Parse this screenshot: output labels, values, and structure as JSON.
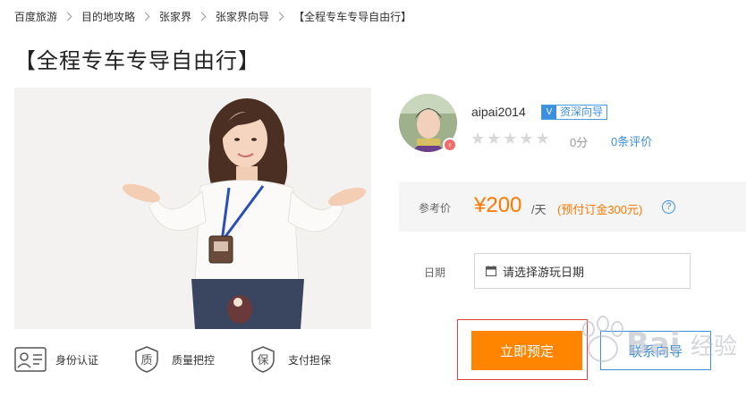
{
  "breadcrumb": [
    "百度旅游",
    "目的地攻略",
    "张家界",
    "张家界向导",
    "【全程专车专导自由行】"
  ],
  "page": {
    "title": "【全程专车专导自由行】"
  },
  "guarantees": [
    {
      "icon": "id-card-icon",
      "label": "身份认证"
    },
    {
      "icon": "quality-icon",
      "label": "质量把控"
    },
    {
      "icon": "payment-guarantee-icon",
      "label": "支付担保"
    }
  ],
  "guide": {
    "name": "aipai2014",
    "level_badge": "V",
    "level": "资深向导",
    "gender_icon": "female-icon",
    "stars": [
      "★",
      "★",
      "★",
      "★",
      "★"
    ],
    "rating": 0,
    "score": "0分",
    "reviews": "0条评价"
  },
  "price": {
    "label": "参考价",
    "value": "¥200",
    "unit": "/天",
    "deposit": "(预付订金300元)",
    "help": "?"
  },
  "booking": {
    "date_label": "日期",
    "date_placeholder": "请选择游玩日期",
    "book_label": "立即预定",
    "contact_label": "联系向导"
  },
  "colors": {
    "accent": "#ff8400",
    "link": "#3b8fe0",
    "highlight": "#e04040"
  }
}
